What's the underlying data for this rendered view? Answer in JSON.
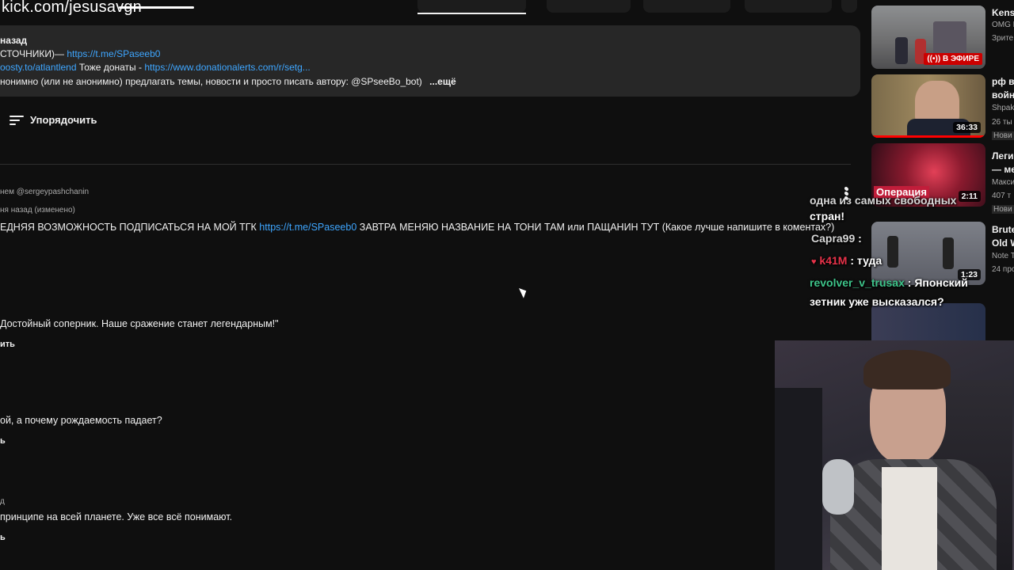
{
  "overlay": {
    "kick_url": "kick.com/jesusavgn"
  },
  "description": {
    "line1_text": "назад",
    "line2_prefix": "СТОЧНИКИ)— ",
    "line2_link": "https://t.me/SPaseeb0",
    "line3_link1": "oosty.to/atlantlend",
    "line3_text": " Тоже донаты - ",
    "line3_link2": "https://www.donationalerts.com/r/setg...",
    "line4_text": "нонимно (или не анонимно) предлагать темы, новости и просто писать автору: @SPseeBo_bot)",
    "more": "...ещё"
  },
  "sort": {
    "label": "Упорядочить"
  },
  "comments": [
    {
      "author": "нем @sergeypashchanin",
      "time": "ня назад (изменено)",
      "text_prefix": "ЕДНЯЯ ВОЗМОЖНОСТЬ ПОДПИСАТЬСЯ НА МОЙ ТГК ",
      "link": "https://t.me/SPaseeb0",
      "text_suffix": "  ЗАВТРА МЕНЯЮ НАЗВАНИЕ НА ТОНИ ТАМ или ПАЩАНИН ТУТ (Какое лучше напишите в коментах?)"
    },
    {
      "text": "Достойный соперник. Наше сражение станет легендарным!\"",
      "reply": "ить"
    },
    {
      "text": "ой, а почему рождаемость падает?",
      "reply": "ь"
    },
    {
      "author": "д",
      "text": "принципе на всей планете. Уже все всё понимают.",
      "reply": "ь"
    }
  ],
  "sidebar": {
    "videos": [
      {
        "title": "Kensi",
        "channel": "OMG L",
        "meta": "Зрите",
        "badge": "В ЭФИРЕ",
        "live": true
      },
      {
        "title": "рф в",
        "title2": "войн",
        "channel": "Shpak",
        "meta": "26 ты",
        "tag": "Нови",
        "duration": "36:33"
      },
      {
        "title": "Леги",
        "title2": "— ме",
        "channel": "Макси",
        "meta": "407 т",
        "tag": "Нови",
        "duration": "2:11",
        "thumb_text": "Операция"
      },
      {
        "title": "Brute",
        "title2": "Old W",
        "channel": "Note T",
        "meta": "24 про",
        "duration": "1:23"
      }
    ]
  },
  "chat": {
    "partial1": "одна из самых свободных",
    "partial2": "стран!",
    "messages": [
      {
        "user": "Capra99",
        "text": " :",
        "color": "#d6d6d6"
      },
      {
        "user": "k41M",
        "text": " : туда",
        "color": "#e8334a"
      },
      {
        "user": "revolver_v_trusax",
        "text": " : Японский",
        "color": "#3ec48a"
      }
    ],
    "continuation": "зетник уже высказался?"
  },
  "colors": {
    "background": "#0f0f0f",
    "surface": "#272727",
    "link": "#3ea6ff",
    "live": "#cc0000"
  }
}
